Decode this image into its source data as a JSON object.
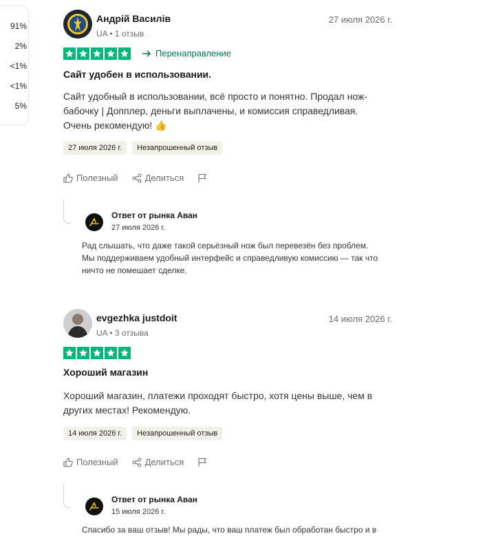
{
  "rating_distribution": [
    "91%",
    "2%",
    "<1%",
    "<1%",
    "5%"
  ],
  "colors": {
    "star_green": "#00b67a",
    "redirect_green": "#04754e",
    "tag_bg": "#f1f1e8"
  },
  "reviews": [
    {
      "author": "Андрій Василів",
      "meta": "UA • 1 отзыв",
      "date": "27 июля 2026 г.",
      "rating": 5,
      "redirect": "Перенаправление",
      "title": "Сайт удобен в использовании.",
      "body_lines": [
        "Сайт удобный в использовании, всё просто и понятно. Продал нож-",
        "бабочку | Допплер, деньги выплачены, и комиссия справедливая.",
        "Очень рекомендую! 👍"
      ],
      "tags": [
        "27 июля 2026 г.",
        "Незапрошенный отзыв"
      ],
      "actions": {
        "useful": "Полезный",
        "share": "Делиться"
      },
      "reply": {
        "title": "Ответ от рынка Аван",
        "date": "27 июля 2026 г.",
        "lines": [
          "Рад слышать, что даже такой серьёзный нож был перевезён без проблем.",
          "Мы поддерживаем удобный интерфейс и справедливую комиссию — так что",
          "ничто не помешает сделке."
        ]
      }
    },
    {
      "author": "evgezhka justdoit",
      "meta": "UA • 3 отзыва",
      "date": "14 июля 2026 г.",
      "rating": 5,
      "title": "Хороший магазин",
      "body_lines": [
        "Хороший магазин, платежи проходят быстро, хотя цены выше, чем в",
        "других местах! Рекомендую."
      ],
      "tags": [
        "14 июля 2026 г.",
        "Незапрошенный отзыв"
      ],
      "actions": {
        "useful": "Полезный",
        "share": "Делиться"
      },
      "reply": {
        "title": "Ответ от рынка Аван",
        "date": "15 июля 2026 г.",
        "lines": [
          "Спасибо за ваш отзыв! Мы рады, что ваш платеж был обработан быстро и в"
        ]
      }
    }
  ]
}
